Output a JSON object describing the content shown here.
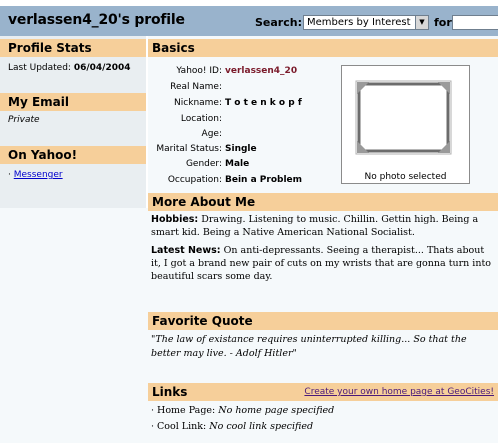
{
  "header": {
    "title": "verlassen4_20's profile",
    "search_label": "Search:",
    "search_select": "Members by Interest",
    "for_label": "for",
    "search_value": ""
  },
  "sidebar": {
    "profile_stats_head": "Profile Stats",
    "last_updated_label": "Last Updated:",
    "last_updated_value": "06/04/2004",
    "my_email_head": "My Email",
    "email_value": "Private",
    "on_yahoo_head": "On Yahoo!",
    "messenger_link": "Messenger"
  },
  "basics": {
    "head": "Basics",
    "rows": [
      {
        "label": "Yahoo! ID:",
        "value": "verlassen4_20"
      },
      {
        "label": "Real Name:",
        "value": ""
      },
      {
        "label": "Nickname:",
        "value": "T o t e n k o p f"
      },
      {
        "label": "Location:",
        "value": ""
      },
      {
        "label": "Age:",
        "value": ""
      },
      {
        "label": "Marital Status:",
        "value": "Single"
      },
      {
        "label": "Gender:",
        "value": "Male"
      },
      {
        "label": "Occupation:",
        "value": "Bein a Problem"
      }
    ],
    "photo_caption": "No photo selected"
  },
  "more_about": {
    "head": "More About Me",
    "hobbies_label": "Hobbies:",
    "hobbies_text": "Drawing. Listening to music. Chillin. Gettin high. Being a smart kid. Being a Native American National Socialist.",
    "news_label": "Latest News:",
    "news_text": "On anti-depressants. Seeing a therapist... Thats about it, I got a brand new pair of cuts on my wrists that are gonna turn into beautiful scars some day."
  },
  "quote": {
    "head": "Favorite Quote",
    "text": "\"The law of existance requires uninterrupted killing... So that the better may live. - Adolf Hitler\""
  },
  "links": {
    "head": "Links",
    "geocities_link": "Create your own home page at GeoCities!",
    "home_label": "· Home Page:",
    "home_value": "No home page specified",
    "cool_label": "· Cool Link:",
    "cool_value": "No cool link specified"
  },
  "colors": {
    "header_bg": "#99b3cc",
    "section_head_bg": "#f6cf9a",
    "sidebar_bg": "#e9eef1",
    "yahoo_id_color": "#7a1a2a"
  }
}
